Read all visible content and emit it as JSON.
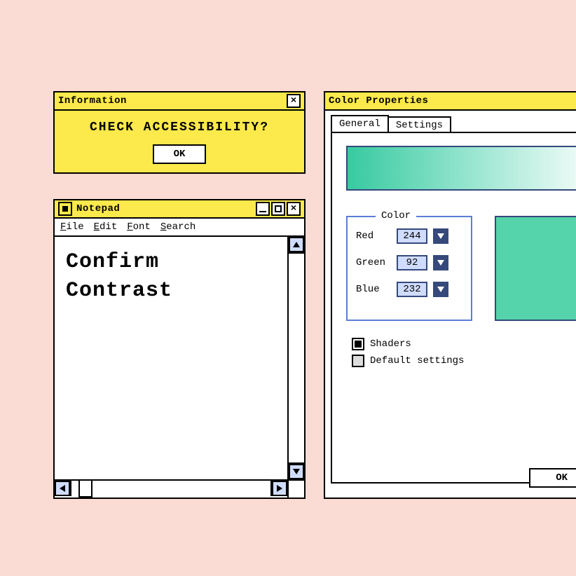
{
  "info": {
    "title": "Information",
    "message": "CHECK ACCESSIBILITY?",
    "ok": "OK"
  },
  "notepad": {
    "title": "Notepad",
    "menus": [
      "File",
      "Edit",
      "Font",
      "Search"
    ],
    "content": "Confirm\nContrast"
  },
  "color": {
    "title": "Color Properties",
    "tabs": [
      "General",
      "Settings"
    ],
    "active_tab": 0,
    "group_label": "Color",
    "channels": [
      {
        "label": "Red",
        "value": "244"
      },
      {
        "label": "Green",
        "value": "92"
      },
      {
        "label": "Blue",
        "value": "232"
      }
    ],
    "checkboxes": [
      {
        "label": "Shaders",
        "checked": true
      },
      {
        "label": "Default settings",
        "checked": false
      }
    ],
    "ok": "OK",
    "preview_gradient": [
      "#37caa0",
      "#ffffff"
    ],
    "swatch_color": "#55d3aa"
  }
}
